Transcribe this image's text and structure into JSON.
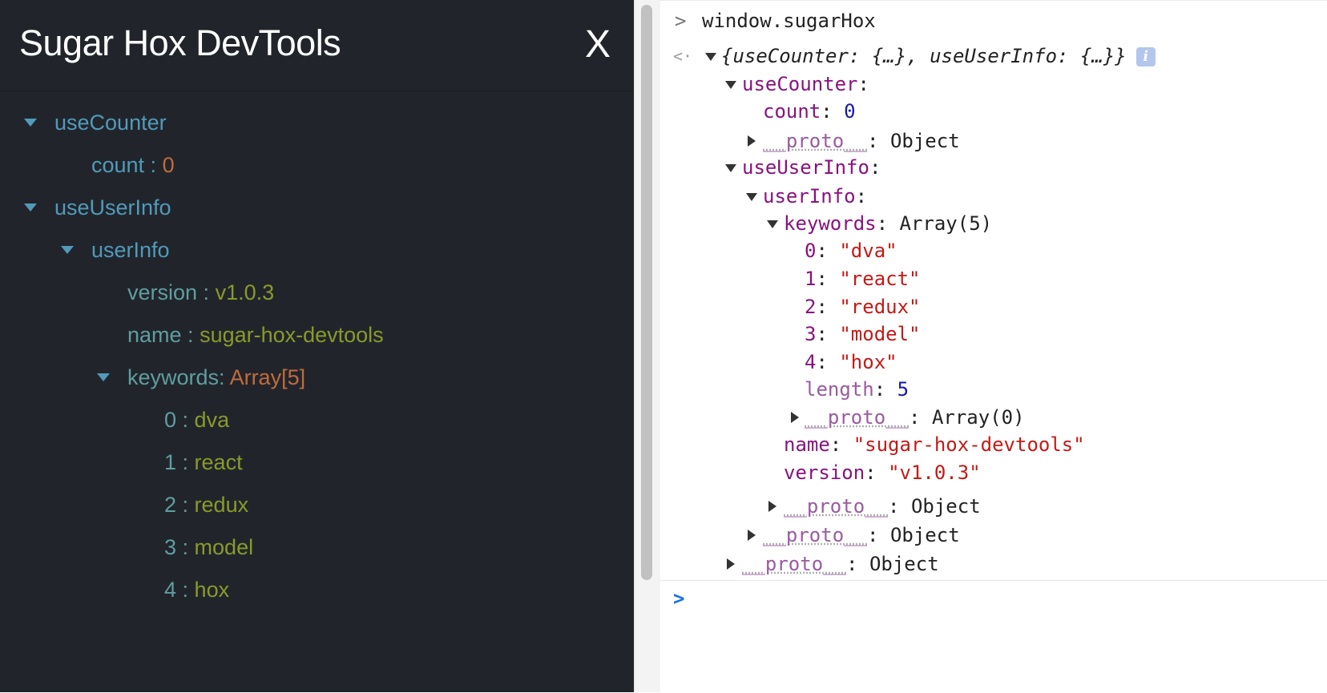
{
  "devtools": {
    "title": "Sugar Hox DevTools",
    "close_label": "X",
    "tree": {
      "use_counter": {
        "key": "useCounter",
        "count_key": "count :",
        "count_value": "0"
      },
      "use_user_info": {
        "key": "useUserInfo",
        "user_info": {
          "key": "userInfo",
          "version_key": "version :",
          "version_value": "v1.0.3",
          "name_key": "name :",
          "name_value": "sugar-hox-devtools",
          "keywords_key": "keywords:",
          "keywords_value": "Array[5]",
          "keywords": [
            {
              "index": "0 :",
              "value": "dva"
            },
            {
              "index": "1 :",
              "value": "react"
            },
            {
              "index": "2 :",
              "value": "redux"
            },
            {
              "index": "3 :",
              "value": "model"
            },
            {
              "index": "4 :",
              "value": "hox"
            }
          ]
        }
      }
    }
  },
  "console": {
    "input_prompt": ">",
    "command": "window.sugarHox",
    "result_prompt": "<·",
    "preview": "{useCounter: {…}, useUserInfo: {…}}",
    "info_icon_label": "i",
    "use_counter_key": "useCounter",
    "count_key": "count",
    "count_value": "0",
    "proto_key": "__proto__",
    "object_label": "Object",
    "use_user_info_key": "useUserInfo",
    "user_info_key": "userInfo",
    "keywords_key": "keywords",
    "keywords_label": "Array(5)",
    "keywords": [
      {
        "index": "0",
        "value": "\"dva\""
      },
      {
        "index": "1",
        "value": "\"react\""
      },
      {
        "index": "2",
        "value": "\"redux\""
      },
      {
        "index": "3",
        "value": "\"model\""
      },
      {
        "index": "4",
        "value": "\"hox\""
      }
    ],
    "length_key": "length",
    "length_value": "5",
    "array0_label": "Array(0)",
    "name_key": "name",
    "name_value": "\"sugar-hox-devtools\"",
    "version_key": "version",
    "version_value": "\"v1.0.3\"",
    "bottom_prompt": ">"
  },
  "colors": {
    "panel_bg": "#21252b",
    "key_teal": "#519aba",
    "value_green": "#8a9a2a",
    "value_orange": "#c26b3c",
    "console_key": "#881280",
    "console_number": "#1a1aa6",
    "console_string": "#c41a16"
  }
}
